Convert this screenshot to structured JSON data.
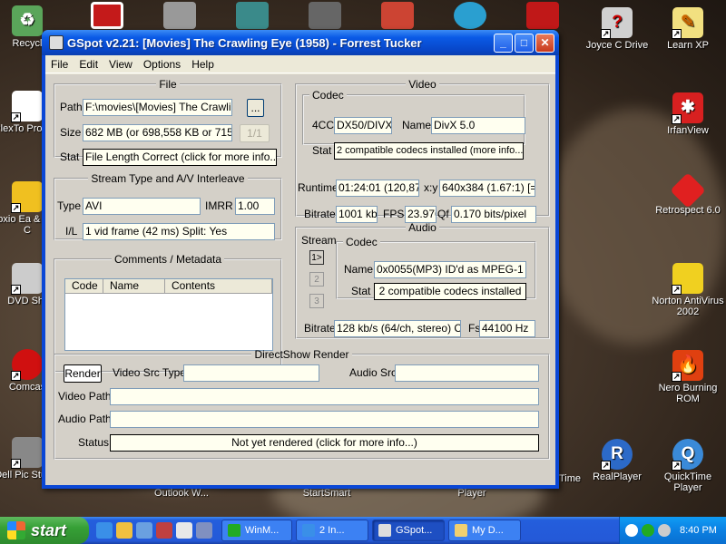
{
  "window": {
    "title": "GSpot v2.21: [Movies]  The Crawling Eye (1958) - Forrest Tucker",
    "minimize": "_",
    "maximize": "□",
    "close": "✕"
  },
  "menu": [
    "File",
    "Edit",
    "View",
    "Options",
    "Help"
  ],
  "file": {
    "legend": "File",
    "path_label": "Path",
    "path_value": "F:\\movies\\[Movies]  The Crawling",
    "browse": "...",
    "size_label": "Size",
    "size_value": "682 MB (or 698,558 KB or 715,32",
    "size_btn": "1/1",
    "stat_label": "Stat",
    "stat_value": "File Length Correct (click for more info...)"
  },
  "stream": {
    "legend": "Stream Type and A/V Interleave",
    "type_label": "Type",
    "type_value": "AVI",
    "imrr_label": "IMRR",
    "imrr_value": "1.00",
    "il_label": "I/L",
    "il_value": "1 vid frame (42 ms)  Split: Yes"
  },
  "comments": {
    "legend": "Comments / Metadata",
    "columns": [
      "Code",
      "Name",
      "Contents"
    ]
  },
  "video": {
    "legend": "Video",
    "codec_legend": "Codec",
    "fourcc_label": "4CC",
    "fourcc_value": "DX50/DIVX",
    "name_label": "Name",
    "name_value": "DivX 5.0",
    "stat_label": "Stat",
    "stat_value": "2 compatible codecs installed (more info...)",
    "runtime_label": "Runtime",
    "runtime_value": "01:24:01 (120,873",
    "xy_label": "x:y",
    "xy_value": "640x384 (1.67:1) [=5:3",
    "bitrate_label": "Bitrate",
    "bitrate_value": "1001 kb/",
    "fps_label": "FPS",
    "fps_value": "23.976",
    "qf_label": "Qf",
    "qf_value": "0.170 bits/pixel"
  },
  "audio": {
    "legend": "Audio",
    "stream_label": "Stream",
    "streams": [
      "1>",
      "2",
      "3"
    ],
    "codec_legend": "Codec",
    "name_label": "Name",
    "name_value": "0x0055(MP3) ID'd as MPEG-1 Laye",
    "stat_label": "Stat",
    "stat_value": "2 compatible codecs installed",
    "bitrate_label": "Bitrate",
    "bitrate_value": "128 kb/s (64/ch, stereo) CBF",
    "fs_label": "Fs",
    "fs_value": "44100 Hz"
  },
  "render": {
    "legend": "DirectShow Render",
    "render_btn": "Render",
    "video_src_label": "Video Src Type",
    "audio_src_label": "Audio Src",
    "video_path_label": "Video Path",
    "audio_path_label": "Audio Path",
    "status_label": "Status",
    "status_value": "Not yet rendered (click for more info...)"
  },
  "desktop_icons": {
    "recycle": "Recycl",
    "plextor": "PlexTo Profess",
    "roxio": "Roxio Ea & DVD C",
    "dvd": "DVD Shr",
    "comcast": "Comcas",
    "dell": "Dell Pic Studio",
    "joyce": "Joyce C Drive",
    "learnxp": "Learn XP",
    "irfanview": "IrfanView",
    "retrospect": "Retrospect 6.0",
    "norton": "Norton AntiVirus 2002",
    "nero": "Nero Burning ROM",
    "realplayer": "RealPlayer",
    "quicktime": "QuickTime Player",
    "outlook": "Outlook W...",
    "startsmart": "StartSmart",
    "player": "Player",
    "time": "Time"
  },
  "taskbar": {
    "start": "start",
    "tasks": [
      "WinM...",
      "2 In...",
      "GSpot...",
      "My D..."
    ],
    "clock": "8:40 PM"
  },
  "colors": {
    "titlebar": "#0a5ae6",
    "field_bg": "#fffff0",
    "taskbar": "#245edc",
    "start": "#36a036"
  }
}
